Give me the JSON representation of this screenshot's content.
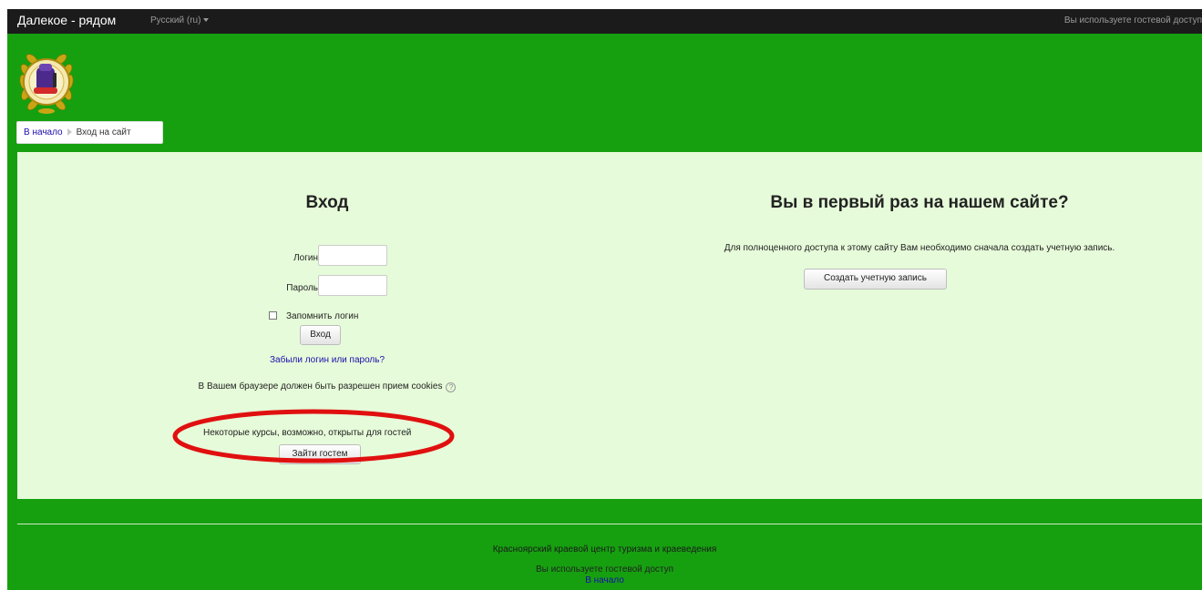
{
  "navbar": {
    "brand": "Далекое - рядом",
    "language": "Русский (ru)",
    "guest_status": "Вы используете гостевой доступ"
  },
  "breadcrumb": {
    "home": "В начало",
    "current": "Вход на сайт"
  },
  "login": {
    "title": "Вход",
    "username_label": "Логин",
    "username_value": "",
    "password_label": "Пароль",
    "password_value": "",
    "remember_label": "Запомнить логин",
    "remember_checked": false,
    "submit_label": "Вход",
    "forgot_link": "Забыли логин или пароль?",
    "cookies_note": "В Вашем браузере должен быть разрешен прием cookies",
    "guest_note": "Некоторые курсы, возможно, открыты для гостей",
    "guest_button": "Зайти гостем"
  },
  "signup": {
    "title": "Вы в первый раз на нашем сайте?",
    "text": "Для полноценного доступа к этому сайту Вам необходимо сначала создать учетную запись.",
    "button": "Создать учетную запись"
  },
  "footer": {
    "organization": "Красноярский краевой центр туризма и краеведения",
    "guest_status": "Вы используете гостевой доступ",
    "home_link": "В начало"
  },
  "colors": {
    "page_background": "#16a010",
    "navbar": "#1b1b1b",
    "content_background": "#e6fbd9",
    "link": "#1a0dab",
    "annotation": "#e01010"
  }
}
